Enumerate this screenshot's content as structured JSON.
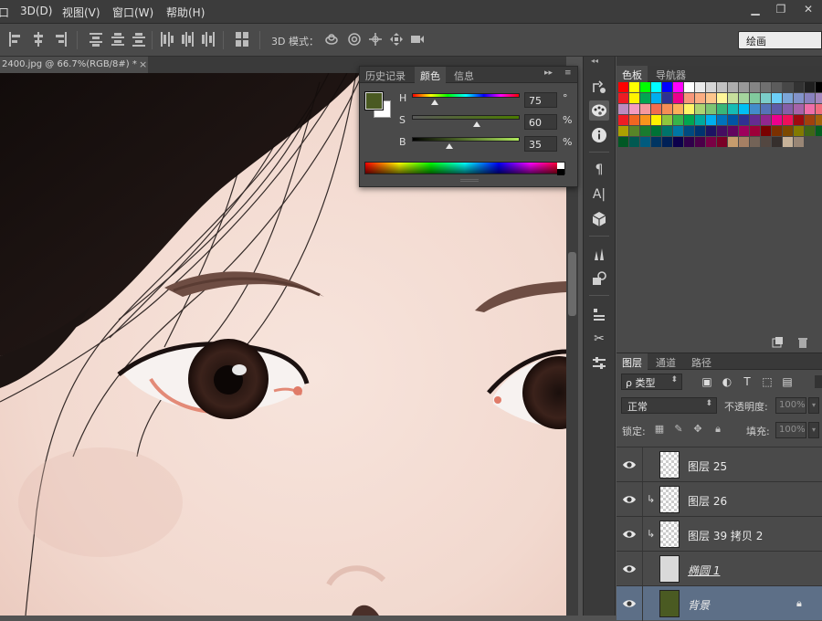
{
  "menubar": {
    "items": [
      "3D(D)",
      "视图(V)",
      "窗口(W)",
      "帮助(H)"
    ],
    "partial_item": "口",
    "window_controls": [
      "minimize-icon",
      "restore-icon",
      "close-icon"
    ]
  },
  "options_bar": {
    "mode_label": "3D 模式：",
    "workspace": "绘画"
  },
  "document": {
    "tab_title": "2400.jpg @ 66.7%(RGB/8#) *",
    "close_glyph": "×"
  },
  "color_panel": {
    "tabs": [
      "历史记录",
      "颜色",
      "信息"
    ],
    "active_tab": "颜色",
    "foreground_color": "#4a5a22",
    "background_color": "#ffffff",
    "sliders": [
      {
        "label": "H",
        "value": "75",
        "unit": "°",
        "fraction": 0.21
      },
      {
        "label": "S",
        "value": "60",
        "unit": "%",
        "fraction": 0.6
      },
      {
        "label": "B",
        "value": "35",
        "unit": "%",
        "fraction": 0.35
      }
    ]
  },
  "swatches_panel": {
    "tabs": [
      "色板",
      "导航器"
    ],
    "active_tab": "色板",
    "colors": [
      "#ff0000",
      "#ffff00",
      "#00ff00",
      "#00ffff",
      "#0000ff",
      "#ff00ff",
      "#ffffff",
      "#ebebeb",
      "#d6d6d6",
      "#c2c2c2",
      "#adadad",
      "#999999",
      "#858585",
      "#707070",
      "#5c5c5c",
      "#474747",
      "#333333",
      "#1f1f1f",
      "#000000",
      "#ed1c24",
      "#fff200",
      "#00a651",
      "#00aeef",
      "#2e3192",
      "#ec008c",
      "#f7977a",
      "#fbad82",
      "#fdc68c",
      "#fff799",
      "#c6df9c",
      "#a4d49d",
      "#81ca9d",
      "#7bcdc9",
      "#6ccff7",
      "#7ca6d8",
      "#8293ca",
      "#8881be",
      "#a286bd",
      "#bc8cbf",
      "#f49bc1",
      "#f5989d",
      "#f26c4f",
      "#f68e55",
      "#fbaf5a",
      "#fff467",
      "#acd372",
      "#7dc473",
      "#39b778",
      "#16bcb4",
      "#00bff3",
      "#438ccb",
      "#5573b7",
      "#5e5ca7",
      "#855fa8",
      "#a763a9",
      "#ef6ea8",
      "#f16d7e",
      "#ee1d24",
      "#f16522",
      "#f7941d",
      "#fff100",
      "#8fc63d",
      "#37b44a",
      "#00a650",
      "#00a99e",
      "#00aeef",
      "#0072bc",
      "#0054a5",
      "#2f3192",
      "#652c91",
      "#91278f",
      "#ed008c",
      "#ee105a",
      "#9d0a0f",
      "#a1410d",
      "#a36209",
      "#aba000",
      "#588528",
      "#197b30",
      "#007236",
      "#00736a",
      "#0076a4",
      "#004a80",
      "#003370",
      "#1d1363",
      "#450e61",
      "#62055f",
      "#9e005c",
      "#9d0039",
      "#790000",
      "#7b3000",
      "#7c4900",
      "#827a00",
      "#3e6617",
      "#045f20",
      "#005824",
      "#005951",
      "#005b7e",
      "#003562",
      "#002056",
      "#0c004b",
      "#30004a",
      "#4b0048",
      "#7a0045",
      "#7a0026",
      "#c69c6d",
      "#a68064",
      "#736357",
      "#534741",
      "#362f2d",
      "#c7b299",
      "#998675"
    ]
  },
  "layers_panel": {
    "tabs": [
      "图层",
      "通道",
      "路径"
    ],
    "active_tab": "图层",
    "filter_label": "ρ 类型",
    "blend_mode": "正常",
    "opacity_label": "不透明度:",
    "opacity_value": "100%",
    "lock_label": "锁定:",
    "fill_label": "填充:",
    "fill_value": "100%",
    "layers": [
      {
        "name": "图层 25",
        "clipped": false,
        "visible": true,
        "selected": false,
        "thumb": "checker"
      },
      {
        "name": "图层 26",
        "clipped": true,
        "visible": true,
        "selected": false,
        "thumb": "checker"
      },
      {
        "name": "图层 39 拷贝 2",
        "clipped": true,
        "visible": true,
        "selected": false,
        "thumb": "checker"
      },
      {
        "name": "椭圆 1",
        "clipped": false,
        "visible": true,
        "selected": false,
        "thumb": "shape"
      },
      {
        "name": "背景",
        "clipped": false,
        "visible": true,
        "selected": true,
        "thumb": "fill",
        "locked": true
      }
    ]
  },
  "tool_strip": {
    "tools": [
      "history-brush-icon",
      "color-palette-icon",
      "info-icon",
      "paragraph-icon",
      "character-icon",
      "3d-cube-icon",
      "brush-presets-icon",
      "clone-source-icon",
      "tool-presets-icon",
      "scissors-icon",
      "properties-icon"
    ]
  }
}
